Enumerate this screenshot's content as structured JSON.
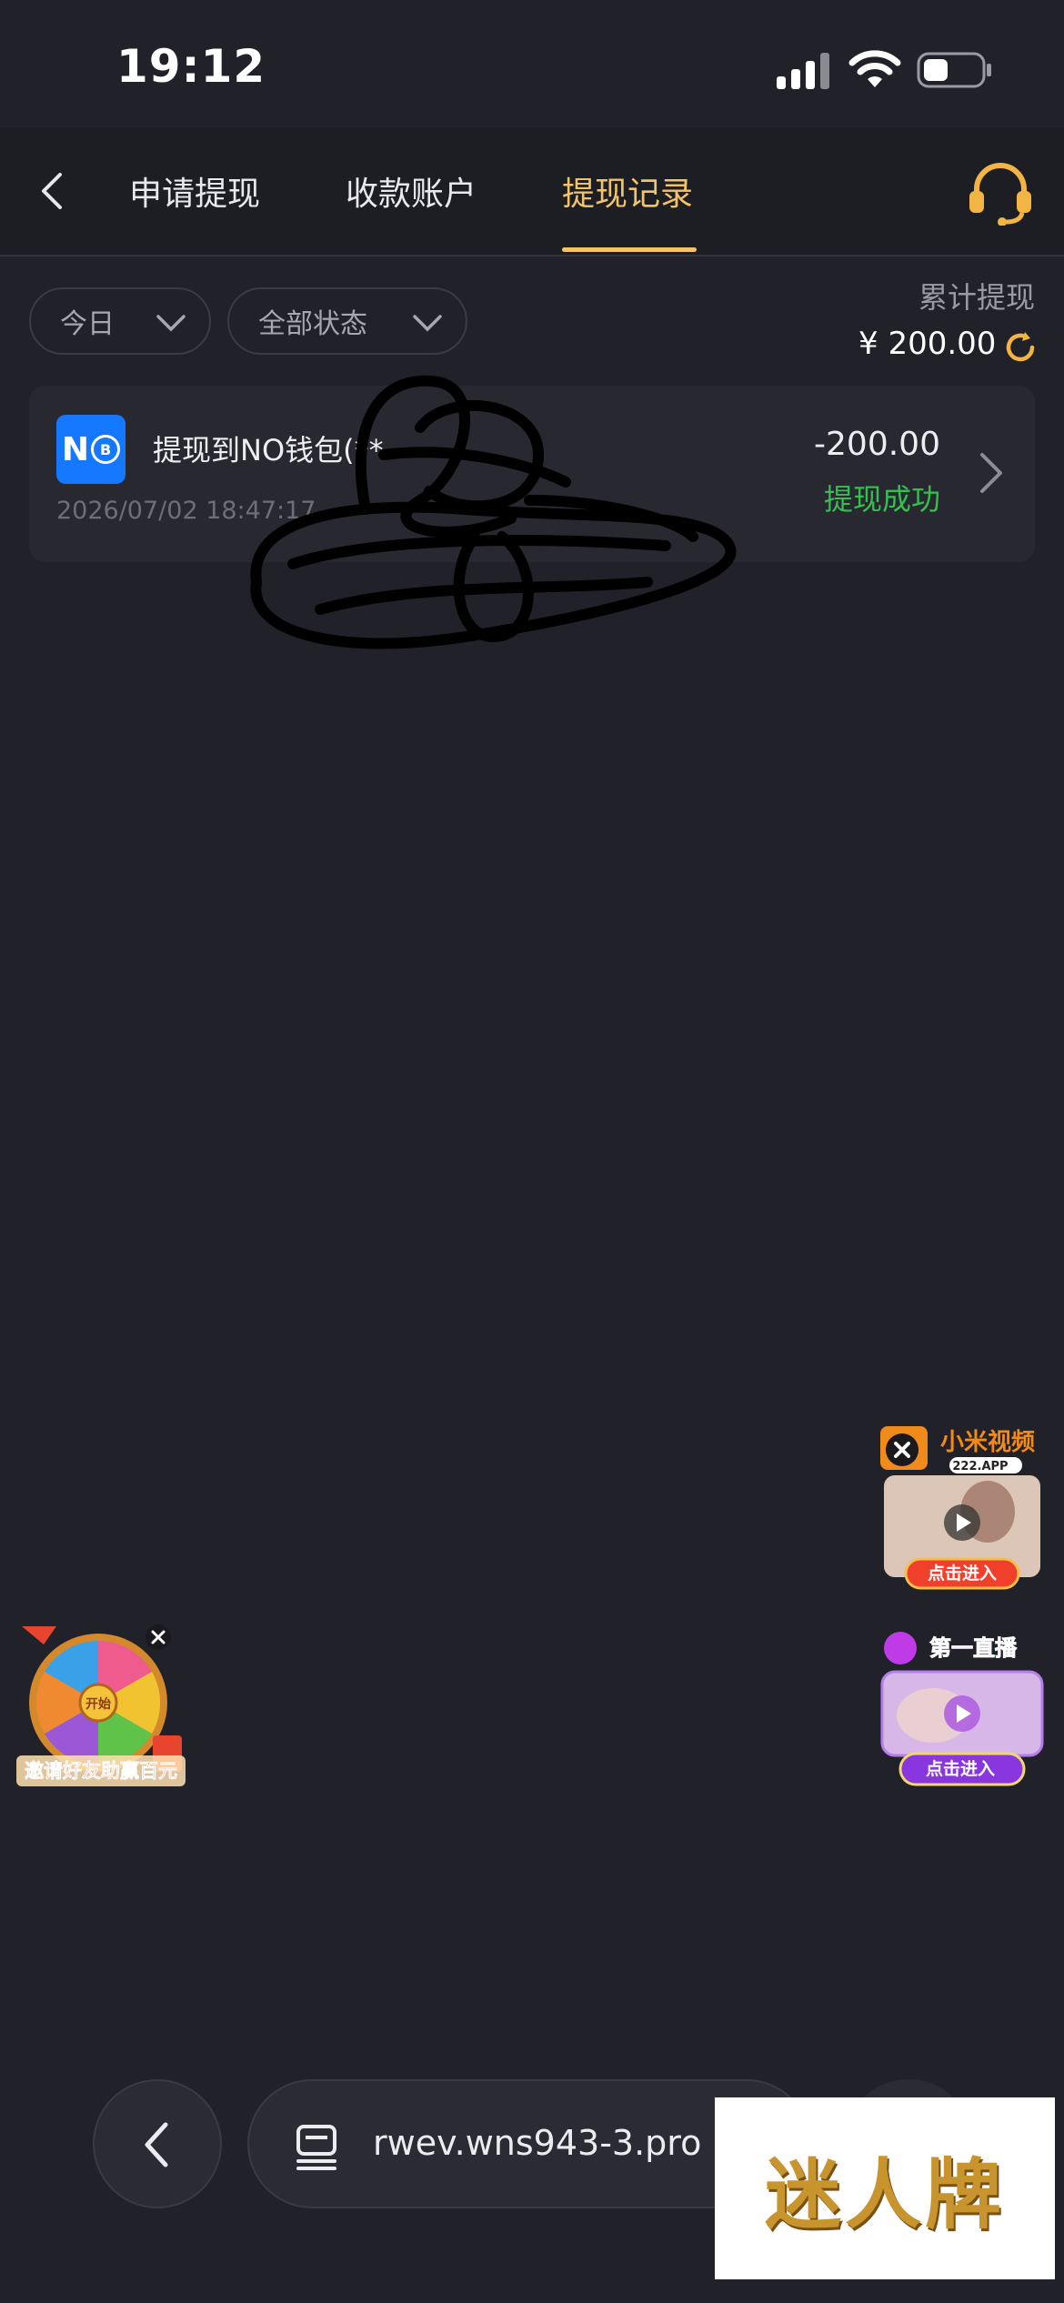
{
  "status_bar": {
    "time": "19:12"
  },
  "nav": {
    "tabs": [
      {
        "label": "申请提现"
      },
      {
        "label": "收款账户"
      },
      {
        "label": "提现记录"
      }
    ],
    "active_tab": 2,
    "accent_color": "#f2c46a"
  },
  "filters": {
    "date": "今日",
    "status": "全部状态"
  },
  "summary": {
    "label": "累计提现",
    "amount": "¥ 200.00"
  },
  "records": [
    {
      "title": "提现到NO钱包(**",
      "time": "2026/07/02 18:47:17",
      "amount": "-200.00",
      "status": "提现成功",
      "status_color": "#33c04e"
    }
  ],
  "ads": {
    "wheel_caption": "邀请好友助赢百元",
    "wheel_center": "开始",
    "xiaomi_title": "小米视频",
    "xiaomi_sub": "222.APP",
    "enter_label": "点击进入",
    "live_title": "第一直播"
  },
  "browser": {
    "url": "rwev.wns943-3.pro"
  },
  "watermark": "迷人牌"
}
